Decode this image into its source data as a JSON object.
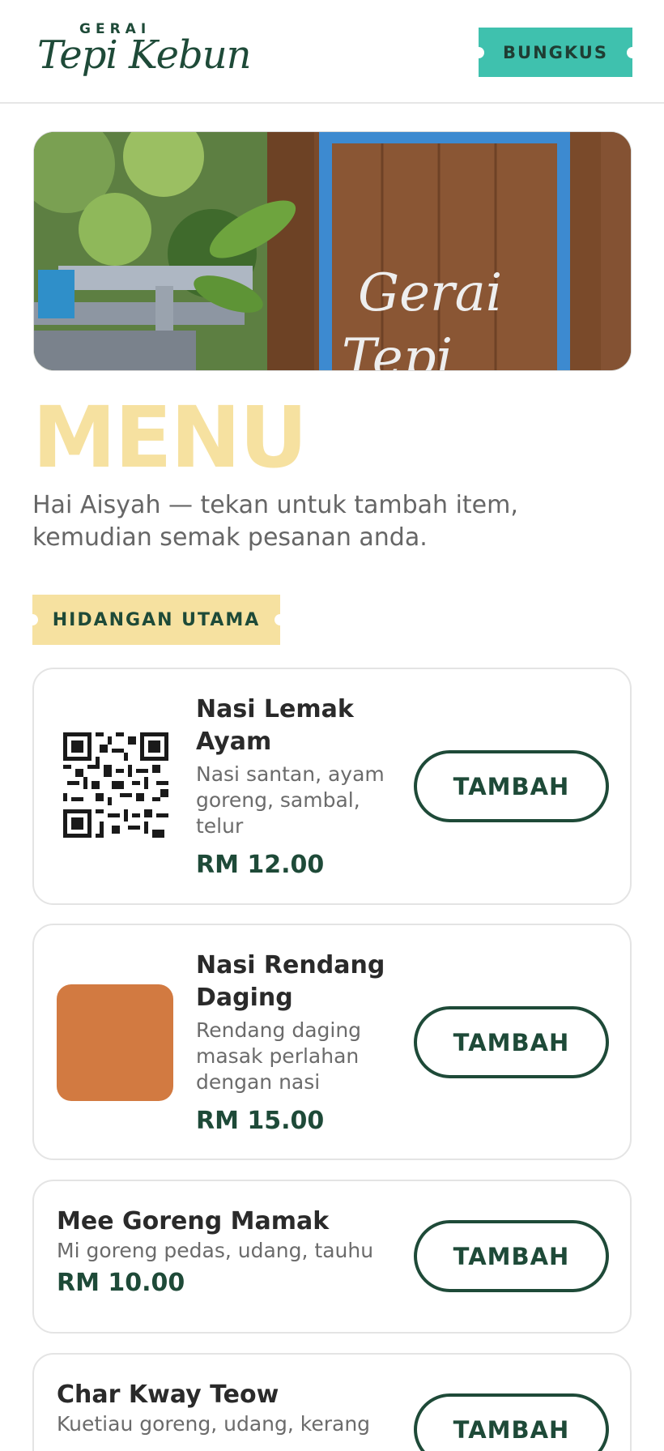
{
  "header": {
    "logo_top": "GERAI",
    "logo_script": "Tepi Kebun",
    "cart_label": "BUNGKUS"
  },
  "hero": {
    "sign_text_1": "Gerai",
    "sign_text_2": "Tepi"
  },
  "page": {
    "title": "MENU",
    "subtitle": "Hai Aisyah — tekan untuk tambah item, kemudian semak pesanan anda."
  },
  "section": {
    "label": "HIDANGAN UTAMA"
  },
  "items": [
    {
      "name": "Nasi Lemak Ayam",
      "desc": "Nasi santan, ayam goreng, sambal, telur",
      "price": "RM 12.00",
      "button": "TAMBAH",
      "thumb": "qr-code"
    },
    {
      "name": "Nasi Rendang Daging",
      "desc": "Rendang daging masak perlahan dengan nasi",
      "price": "RM 15.00",
      "button": "TAMBAH",
      "thumb_color": "#d27a41"
    },
    {
      "name": "Mee Goreng Mamak",
      "desc": "Mi goreng pedas, udang, tauhu",
      "price": "RM 10.00",
      "button": "TAMBAH"
    },
    {
      "name": "Char Kway Teow",
      "desc": "Kuetiau goreng, udang, kerang",
      "price": "",
      "button": "TAMBAH"
    }
  ],
  "colors": {
    "brand_green": "#1e4a38",
    "accent_teal": "#3fc1ae",
    "accent_yellow": "#f6e1a0"
  }
}
